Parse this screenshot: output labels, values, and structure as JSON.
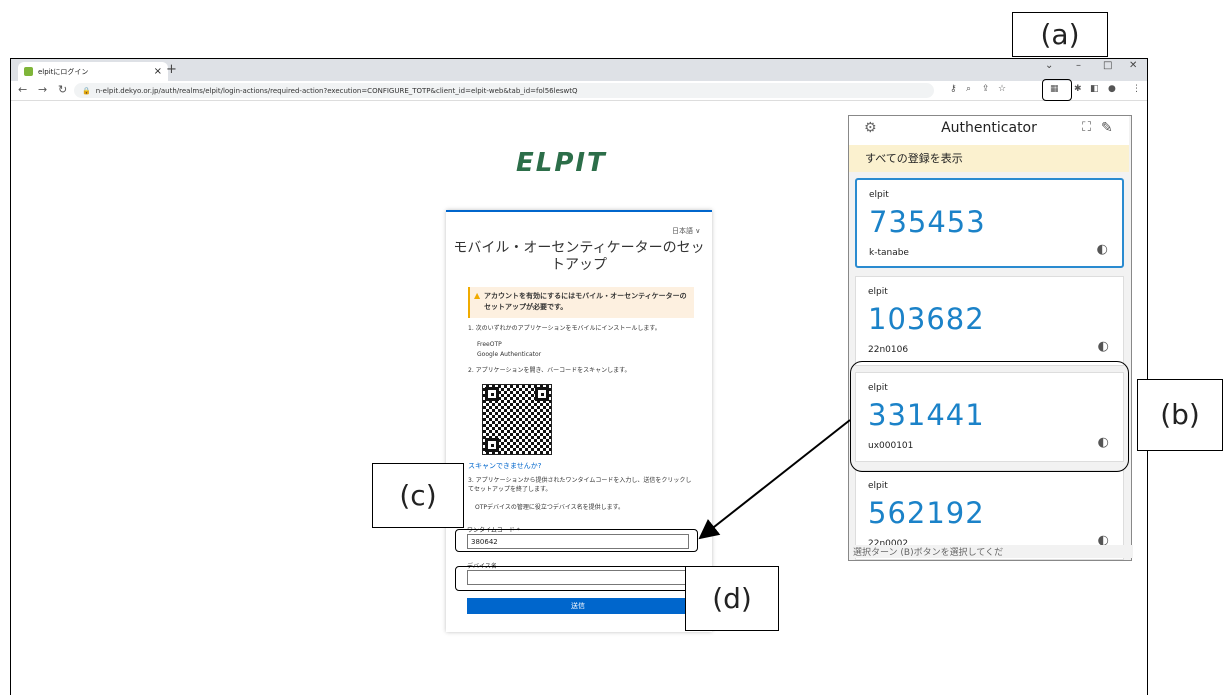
{
  "browser": {
    "tab_title": "elpitにログイン",
    "tab_close": "×",
    "new_tab": "+",
    "url": "n-elpit.dekyo.or.jp/auth/realms/elpit/login-actions/required-action?execution=CONFIGURE_TOTP&client_id=elpit-web&tab_id=fol56leswtQ"
  },
  "page": {
    "logo": "ELPIT",
    "language": "日本語 ∨",
    "heading": "モバイル・オーセンティケーターのセットアップ",
    "warning": "アカウントを有効にするにはモバイル・オーセンティケーターのセットアップが必要です。",
    "step1": "1. 次のいずれかのアプリケーションをモバイルにインストールします。",
    "apps": [
      "FreeOTP",
      "Google Authenticator"
    ],
    "step2": "2. アプリケーションを開き、バーコードをスキャンします。",
    "scan_link": "スキャンできませんか?",
    "step3": "3. アプリケーションから提供されたワンタイムコードを入力し、送信をクリックしてセットアップを終了します。",
    "device_hint": "OTPデバイスの管理に役立つデバイス名を提供します。",
    "otp_label": "ワンタイムコード *",
    "otp_value": "380642",
    "device_label": "デバイス名",
    "submit": "送信"
  },
  "authenticator": {
    "title": "Authenticator",
    "show_all": "すべての登録を表示",
    "accounts": [
      {
        "issuer": "elpit",
        "code": "735453",
        "user": "k-tanabe"
      },
      {
        "issuer": "elpit",
        "code": "103682",
        "user": "22n0106"
      },
      {
        "issuer": "elpit",
        "code": "331441",
        "user": "ux000101"
      },
      {
        "issuer": "elpit",
        "code": "562192",
        "user": "22n0002"
      }
    ],
    "footer": "選択ターン (B)ボタンを選択してくだ",
    "icon": "moon-timer-icon",
    "accent": "#1b82c8"
  },
  "annotations": {
    "a": "(a)",
    "b": "(b)",
    "c": "(c)",
    "d": "(d)"
  }
}
